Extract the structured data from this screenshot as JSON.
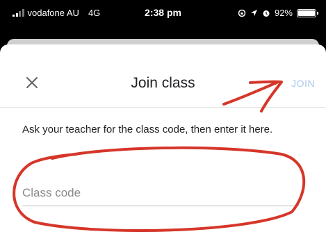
{
  "status_bar": {
    "carrier": "vodafone AU",
    "network": "4G",
    "time": "2:38 pm",
    "battery": "92%",
    "icons": [
      "signal-icon",
      "location-icon",
      "alarm-icon",
      "rotation-lock-icon",
      "battery-icon"
    ]
  },
  "dialog": {
    "title": "Join class",
    "join_label": "JOIN",
    "close_icon": "close-icon",
    "instruction": "Ask your teacher for the class code, then enter it here.",
    "class_code": {
      "placeholder": "Class code",
      "value": ""
    }
  },
  "colors": {
    "join_disabled": "#a9c7ee",
    "annotation_red": "#d6362a"
  }
}
